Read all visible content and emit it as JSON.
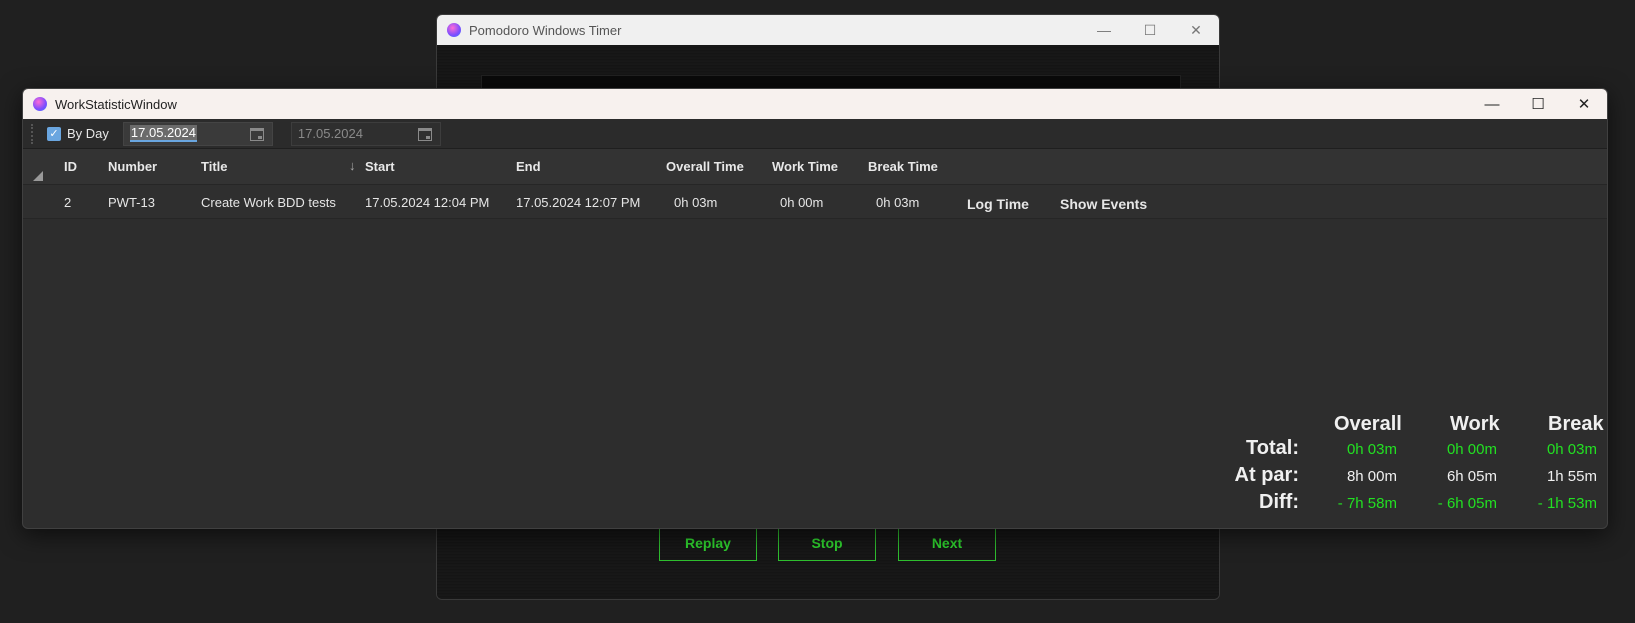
{
  "bg_window": {
    "title": "Pomodoro Windows Timer",
    "buttons": {
      "replay": "Replay",
      "stop": "Stop",
      "next": "Next"
    },
    "controls": {
      "minimize": "—",
      "maximize": "☐",
      "close": "✕"
    }
  },
  "window": {
    "title": "WorkStatisticWindow",
    "controls": {
      "minimize": "—",
      "maximize": "☐",
      "close": "✕"
    }
  },
  "toolbar": {
    "by_day_label": "By Day",
    "by_day_checked": true,
    "date_from": "17.05.2024",
    "date_to": "17.05.2024"
  },
  "grid": {
    "columns": [
      "ID",
      "Number",
      "Title",
      "Start",
      "End",
      "Overall Time",
      "Work Time",
      "Break Time"
    ],
    "sorted_column": "Start",
    "rows": [
      {
        "id": "2",
        "number": "PWT-13",
        "title": "Create Work BDD tests",
        "start": "17.05.2024 12:04 PM",
        "end": "17.05.2024 12:07 PM",
        "overall": "0h 03m",
        "work": "0h 00m",
        "break": "0h 03m",
        "log_time": "Log Time",
        "show_events": "Show Events"
      }
    ]
  },
  "summary": {
    "headers": [
      "Overall",
      "Work",
      "Break"
    ],
    "total": {
      "label": "Total:",
      "overall": "0h 03m",
      "work": "0h 00m",
      "break": "0h 03m"
    },
    "at_par": {
      "label": "At par:",
      "overall": "8h 00m",
      "work": "6h 05m",
      "break": "1h 55m"
    },
    "diff": {
      "label": "Diff:",
      "overall": "- 7h 58m",
      "work": "- 6h 05m",
      "break": "- 1h 53m"
    }
  },
  "colors": {
    "positive": "#22e022",
    "accent": "#6aa6e0",
    "button_green": "#2fbf2f"
  }
}
